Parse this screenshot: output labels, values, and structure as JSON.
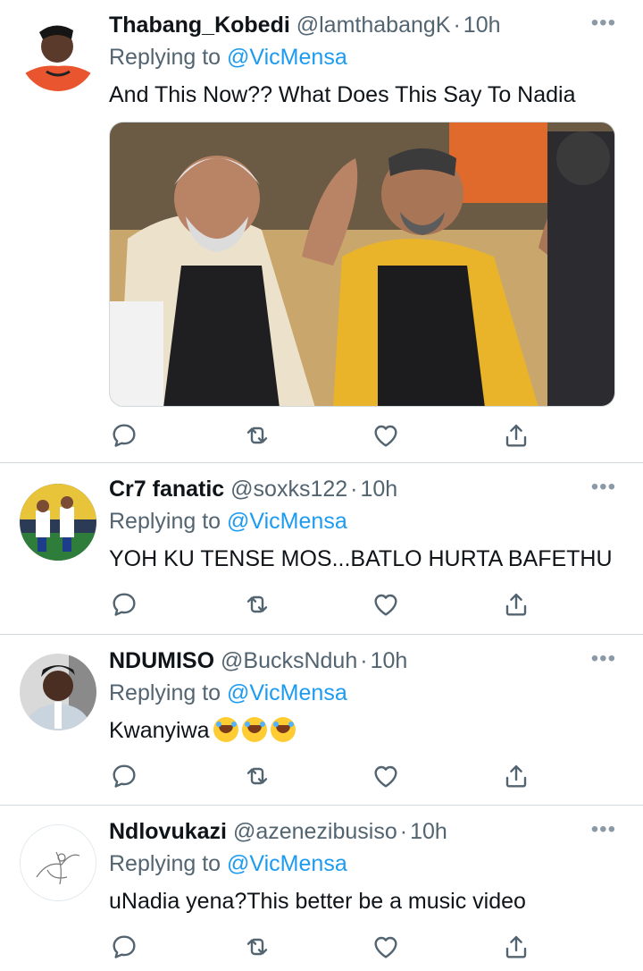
{
  "tweets": [
    {
      "name": "Thabang_Kobedi",
      "handle": "@lamthabangK",
      "time": "10h",
      "replying_prefix": "Replying to ",
      "replying_to": "@VicMensa",
      "text": "And This Now?? What Does This Say To Nadia",
      "has_media": true
    },
    {
      "name": "Cr7 fanatic",
      "handle": "@soxks122",
      "time": "10h",
      "replying_prefix": "Replying to ",
      "replying_to": "@VicMensa",
      "text": "YOH KU TENSE MOS...BATLO HURTA BAFETHU"
    },
    {
      "name": "NDUMISO",
      "handle": "@BucksNduh",
      "time": "10h",
      "replying_prefix": "Replying to ",
      "replying_to": "@VicMensa",
      "text": "Kwanyiwa"
    },
    {
      "name": "Ndlovukazi",
      "handle": "@azenezibusiso",
      "time": "10h",
      "replying_prefix": "Replying to ",
      "replying_to": "@VicMensa",
      "text": "uNadia yena?This better be a music video"
    }
  ],
  "ui": {
    "separator": "·",
    "more_label": "•••"
  },
  "icons": [
    "reply-icon",
    "retweet-icon",
    "like-icon",
    "share-icon",
    "more-icon"
  ],
  "colors": {
    "text": "#0f1419",
    "secondary": "#536471",
    "link": "#1d9bf0",
    "divider": "#cfd9de"
  }
}
